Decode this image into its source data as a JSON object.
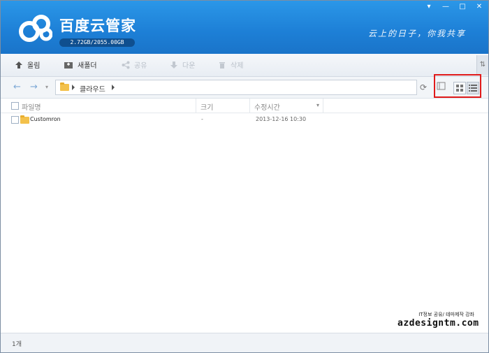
{
  "app": {
    "title": "百度云管家",
    "quota": "2.72GB/2055.00GB",
    "slogan": "云上的日子，你我共享",
    "window_controls": [
      "▾",
      "—",
      "□",
      "✕"
    ]
  },
  "toolbar": {
    "upload": "올림",
    "new_folder": "새폴더",
    "share": "공유",
    "download": "다운",
    "delete": "삭제"
  },
  "nav": {
    "back_icon": "arrow-left",
    "forward_icon": "arrow-right",
    "path": [
      "클라우드"
    ],
    "view_modes": [
      "preview",
      "grid",
      "list"
    ],
    "active_view": "list"
  },
  "columns": {
    "name": "파일명",
    "size": "크기",
    "modified": "수정시간"
  },
  "files": [
    {
      "name": "Customron",
      "size": "-",
      "modified": "2013-12-16 10:30"
    }
  ],
  "status": {
    "count": "1개"
  },
  "watermark": {
    "line1": "IT정보 공유/ 테마제작 강좌",
    "line2": "azdesigntm.com"
  },
  "colors": {
    "header_top": "#2b97e8",
    "header_bottom": "#1a74c9",
    "highlight": "#e01a1a",
    "folder": "#f3c14b"
  }
}
